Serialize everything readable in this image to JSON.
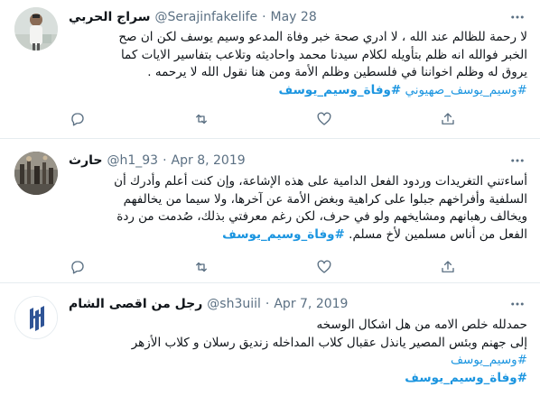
{
  "tweets": [
    {
      "display_name": "سراج الحربي",
      "handle": "@Serajinfakelife",
      "date": "May 28",
      "lines": [
        "لا رحمة للظالم عند الله ، لا ادري صحة خبر وفاة المدعو وسيم يوسف لكن ان صح",
        "الخبر فوالله انه ظلم  بتأويله لكلام سيدنا محمد واحاديثه وتلاعب بتفاسير الايات كما",
        "يروق له وظلم اخواننا في فلسطين وظلم الأمة ومن هنا نقول الله لا يرحمه ."
      ],
      "tags_line": {
        "tag1": "#وسيم_يوسف_صهيوني",
        "tag2": "#وفاة_وسيم_يوسف"
      }
    },
    {
      "display_name": "حارث",
      "handle": "@h1_93",
      "date": "Apr 8, 2019",
      "lines": [
        "أساءتني التغريدات وردود الفعل الدامية على هذه الإشاعة، وإن كنت أعلم وأدرك أن",
        "السلفية وأفراخهم جبلوا على كراهية وبغض الأمة عن آخرها، ولا سيما من يخالفهم",
        "ويخالف رهبانهم ومشايخهم ولو في حرف، لكن رغم معرفتي بذلك، صُدمت من ردة"
      ],
      "last_text": "الفعل من أناس مسلمين لأخ مسلم.",
      "last_tag": "#وفاة_وسيم_يوسف"
    },
    {
      "display_name": "رجل من اقصى الشام",
      "handle": "@sh3uiil",
      "date": "Apr 7, 2019",
      "lines": [
        "حمدلله خلص الامه من هل اشكال الوسخه",
        "إلى جهنم وبئس المصير يانذل عقبال كلاب المداخله   زنديق رسلان و كلاب الأزهر"
      ],
      "tag_a": "#وسيم_يوسف",
      "tag_b": "#وفاة_وسيم_يوسف"
    }
  ],
  "icons": {
    "more": "more-horizontal-icon",
    "reply": "reply-icon",
    "retweet": "retweet-icon",
    "like": "like-icon",
    "share": "share-icon"
  },
  "colors": {
    "link": "#1b95e0",
    "muted": "#5b7083",
    "text": "#0f1419",
    "divider": "#e6ecf0"
  }
}
